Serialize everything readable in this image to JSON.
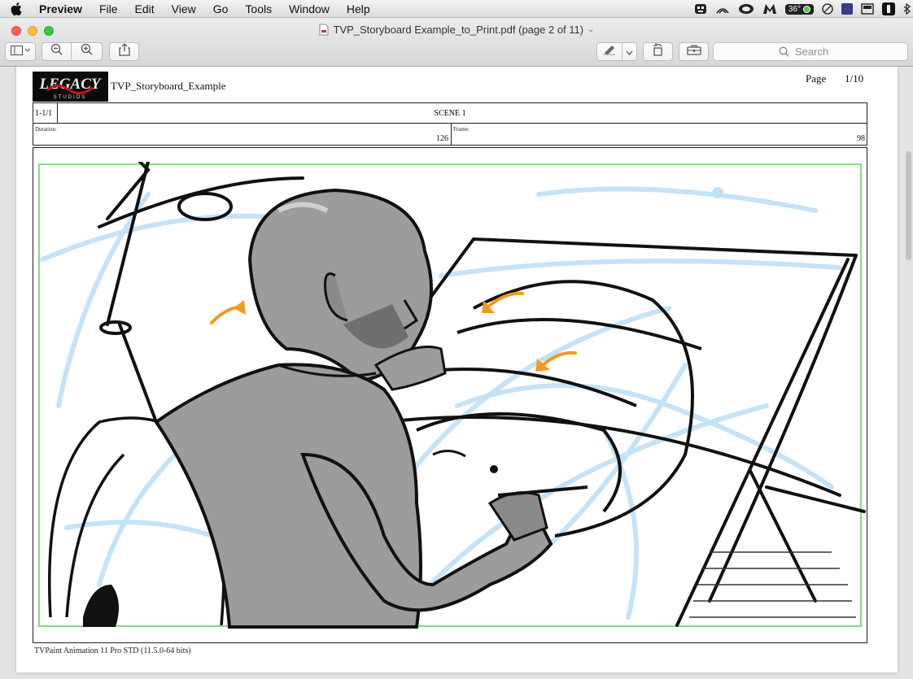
{
  "menubar": {
    "app_name": "Preview",
    "items": [
      "File",
      "Edit",
      "View",
      "Go",
      "Tools",
      "Window",
      "Help"
    ],
    "temperature": "36°"
  },
  "window": {
    "title": "TVP_Storyboard Example_to_Print.pdf (page 2 of 11)"
  },
  "toolbar": {
    "search_placeholder": "Search"
  },
  "document": {
    "logo_text": "LEGACY",
    "logo_subtext": "STUDIOS",
    "doc_name": "TVP_Storyboard_Example",
    "page_label": "Page",
    "page_number": "1/10",
    "shot_id": "1-1/1",
    "scene_title": "SCENE 1",
    "duration_label": "Duration:",
    "duration_value": "126",
    "frame_label": "Frame:",
    "frame_value": "98",
    "footer": "TVPaint Animation 11 Pro STD (11.5.0-64 bits)"
  },
  "colors": {
    "sketch_blue": "#bfe0f7",
    "figure_gray": "#9c9c9c",
    "arrow_orange": "#f39a1e",
    "frame_green": "#8ad98a"
  }
}
